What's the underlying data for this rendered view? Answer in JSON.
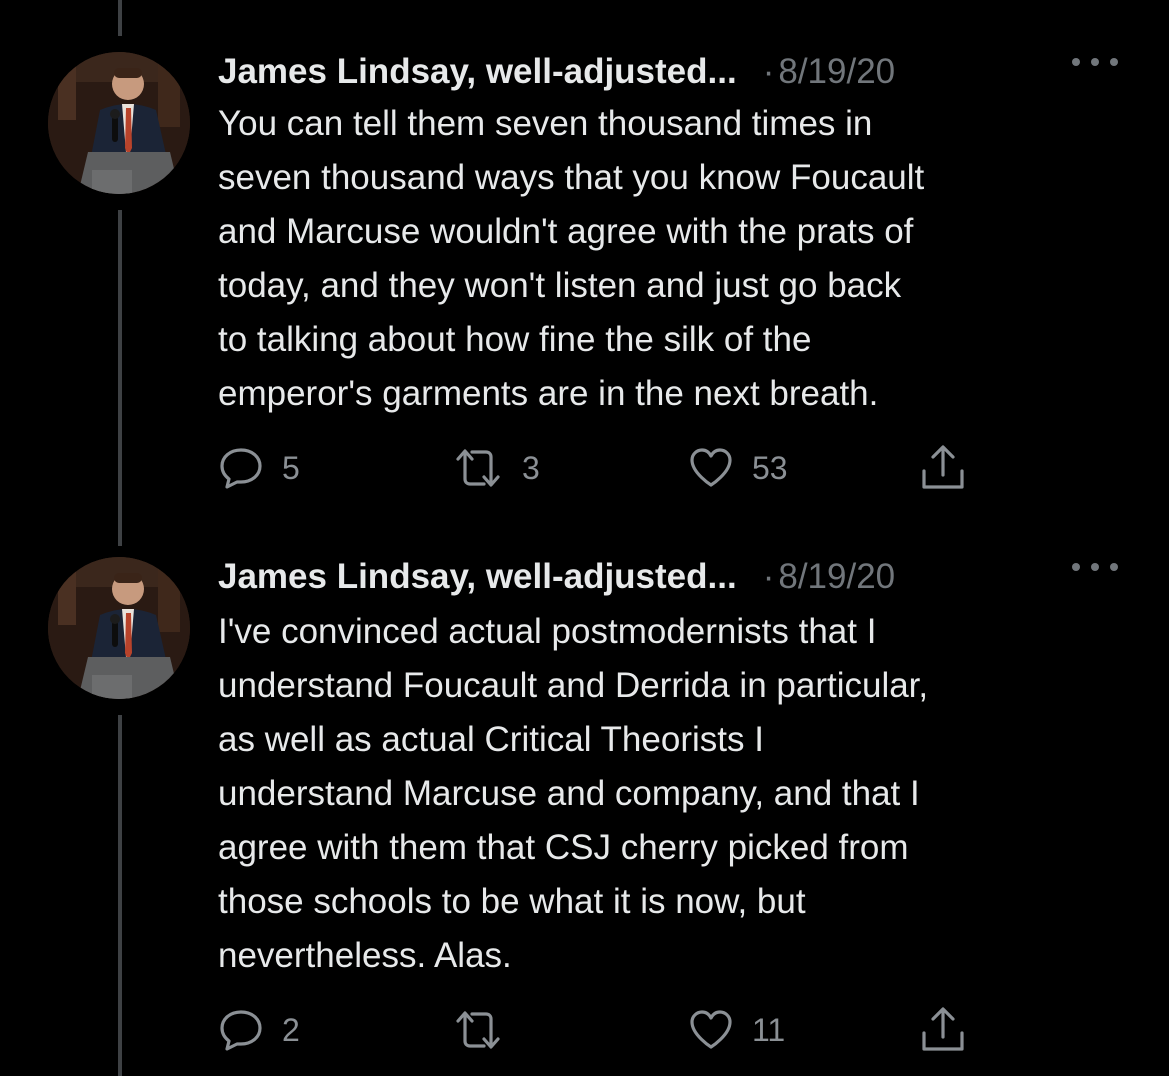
{
  "tweets": [
    {
      "author": "James Lindsay, well-adjusted...",
      "separator": "·",
      "date": "8/19/20",
      "lines": [
        "You can tell them seven thousand times in",
        "seven thousand ways that you know Foucault",
        "and Marcuse wouldn't agree with the prats of",
        "today, and they won't listen and just go back",
        "to talking about how fine the silk of the",
        "emperor's garments are in the next breath."
      ],
      "replies": "5",
      "retweets": "3",
      "likes": "53"
    },
    {
      "author": "James Lindsay, well-adjusted...",
      "separator": "·",
      "date": "8/19/20",
      "lines": [
        "I've convinced actual postmodernists that I",
        "understand Foucault and Derrida in particular,",
        "as well as actual Critical Theorists I",
        "understand Marcuse and company, and that I",
        "agree with them that CSJ cherry picked from",
        "those schools to be what it is now, but",
        "nevertheless. Alas."
      ],
      "replies": "2",
      "retweets": "",
      "likes": "11"
    }
  ],
  "icons": {
    "reply": "reply-icon",
    "retweet": "retweet-icon",
    "like": "heart-icon",
    "share": "share-icon",
    "more": "more-icon"
  },
  "colors": {
    "background": "#000000",
    "text": "#e7e9ea",
    "secondary": "#71767b",
    "thread_line": "#3e4144"
  }
}
